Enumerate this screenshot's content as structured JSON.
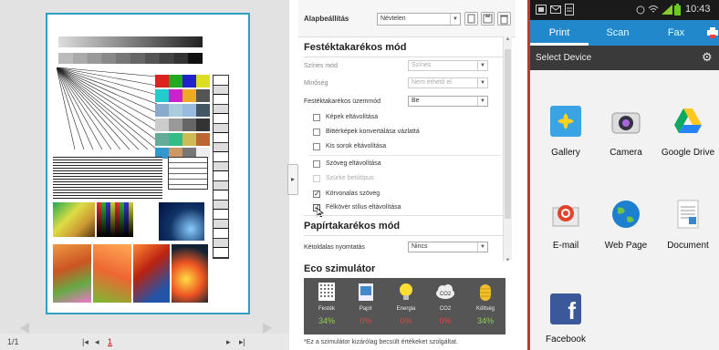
{
  "preview": {
    "page_current": "1/1",
    "page_link": "1"
  },
  "settings": {
    "profile_label": "Alapbeállítás",
    "profile_value": "Névtelen",
    "section_ink": "Festéktakarékos mód",
    "color_mode_label": "Színes mód",
    "color_mode_value": "Színes",
    "quality_label": "Minőség",
    "quality_value": "Nem érhető el",
    "ink_mode_label": "Festéktakarékos üzemmód",
    "ink_mode_value": "Be",
    "checkboxes": [
      {
        "label": "Képek eltávolítása",
        "checked": false,
        "disabled": false
      },
      {
        "label": "Bittérképek konvertálása vázlattá",
        "checked": false,
        "disabled": false
      },
      {
        "label": "Kis sorok eltávolítása",
        "checked": false,
        "disabled": false
      },
      {
        "label": "Szöveg eltávolítása",
        "checked": false,
        "disabled": false
      },
      {
        "label": "Szürke betűtípus",
        "checked": false,
        "disabled": true
      },
      {
        "label": "Körvonalas szöveg",
        "checked": true,
        "disabled": false
      },
      {
        "label": "Félkövér stílus eltávolítása",
        "checked": true,
        "disabled": false
      }
    ],
    "check_mark": "✓",
    "section_paper": "Papírtakarékos mód",
    "duplex_label": "Kétoldalas nyomtatás",
    "duplex_value": "Nincs",
    "eco_title": "Eco szimulátor",
    "eco_items": [
      {
        "name": "Festék",
        "value": "34%",
        "color": "#8fd14f",
        "icon": "toner-icon"
      },
      {
        "name": "Papír",
        "value": "0%",
        "color": "#e0443a",
        "icon": "paper-icon"
      },
      {
        "name": "Energia",
        "value": "0%",
        "color": "#e0443a",
        "icon": "bulb-icon"
      },
      {
        "name": "CO2",
        "value": "0%",
        "color": "#e0443a",
        "icon": "co2-cloud-icon"
      },
      {
        "name": "Költség",
        "value": "34%",
        "color": "#8fd14f",
        "icon": "coins-icon"
      }
    ],
    "co2_icon_text": "CO2",
    "eco_footnote": "*Ez a szimulátor kizárólag becsült értékeket szolgáltat."
  },
  "phone": {
    "time": "10:43",
    "tabs": [
      "Print",
      "Scan",
      "Fax"
    ],
    "active_tab": "Print",
    "select_device": "Select Device",
    "apps": [
      {
        "label": "Gallery",
        "icon": "gallery-icon"
      },
      {
        "label": "Camera",
        "icon": "camera-icon"
      },
      {
        "label": "Google Drive",
        "icon": "google-drive-icon"
      },
      {
        "label": "E-mail",
        "icon": "email-icon"
      },
      {
        "label": "Web Page",
        "icon": "web-page-icon"
      },
      {
        "label": "Document",
        "icon": "document-icon"
      },
      {
        "label": "Facebook",
        "icon": "facebook-icon"
      }
    ],
    "facebook_glyph": "f",
    "accent": "#2288cc",
    "border_color": "#c0392b"
  }
}
